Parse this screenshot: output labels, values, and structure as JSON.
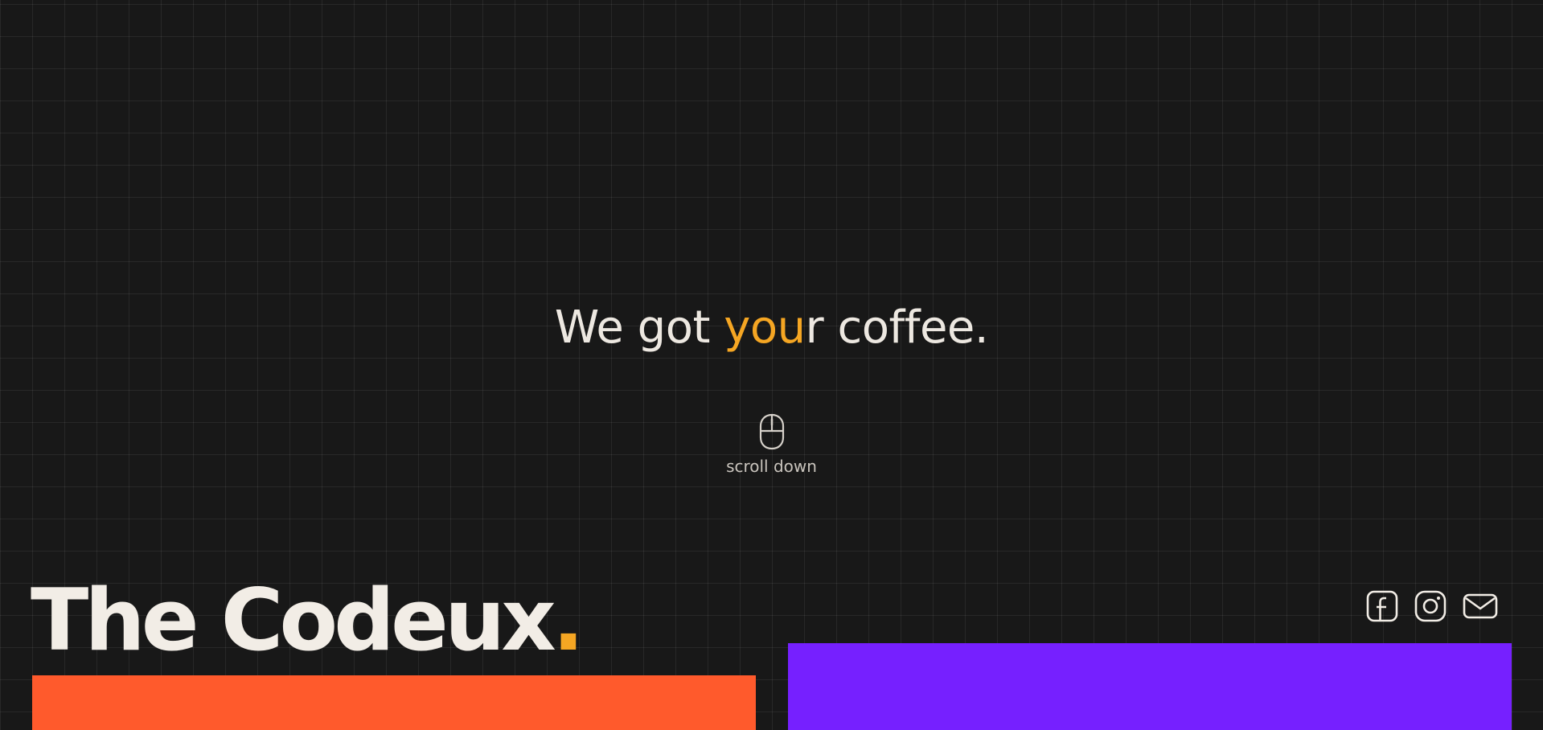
{
  "hero": {
    "tagline_prefix": "We got ",
    "tagline_highlight": "you",
    "tagline_suffix": "r coffee."
  },
  "scroll": {
    "label": "scroll down",
    "icon": "mouse-icon"
  },
  "brand": {
    "name": "The Codeux",
    "dot": "."
  },
  "socials": [
    {
      "icon": "facebook-icon"
    },
    {
      "icon": "instagram-icon"
    },
    {
      "icon": "mail-icon"
    }
  ],
  "colors": {
    "background": "#181818",
    "text": "#ede8e1",
    "accent": "#f5a623",
    "orange_panel": "#ff5a2c",
    "purple_panel": "#7620ff"
  }
}
